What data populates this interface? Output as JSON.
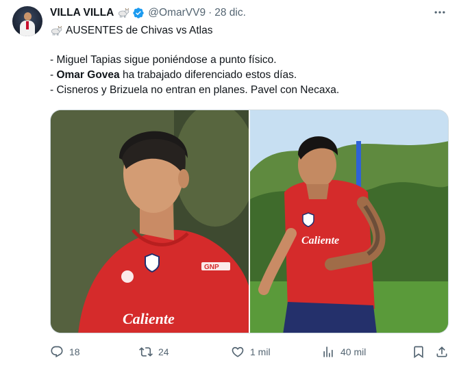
{
  "author": {
    "name": "VILLA VILLA",
    "handle": "@OmarVV9",
    "separator": "·",
    "date": "28 dic."
  },
  "tweet": {
    "title": "AUSENTES de Chivas vs Atlas",
    "line1": "- Miguel Tapias sigue poniéndose a punto físico.",
    "line2_prefix": "- ",
    "line2_bold": "Omar Govea",
    "line2_rest": " ha trabajado diferenciado estos días.",
    "line3": "- Cisneros y Brizuela no entran en planes. Pavel con Necaxa."
  },
  "media": {
    "left_jersey_brand": "GNP",
    "left_jersey_sponsor": "Caliente",
    "right_jersey_sponsor": "Caliente"
  },
  "actions": {
    "replies": "18",
    "reposts": "24",
    "likes": "1 mil",
    "views": "40 mil"
  },
  "colors": {
    "text_primary": "#0f1419",
    "text_secondary": "#536471",
    "verified": "#1d9bf0",
    "jersey_red": "#d52b2b",
    "shorts_navy": "#24306b"
  },
  "icons": {
    "reply": "reply-icon",
    "repost": "repost-icon",
    "like": "heart-icon",
    "views": "views-icon",
    "bookmark": "bookmark-icon",
    "share": "share-icon",
    "more": "more-options-icon",
    "verified": "verified-badge-icon",
    "goat": "goat-emoji-icon"
  }
}
